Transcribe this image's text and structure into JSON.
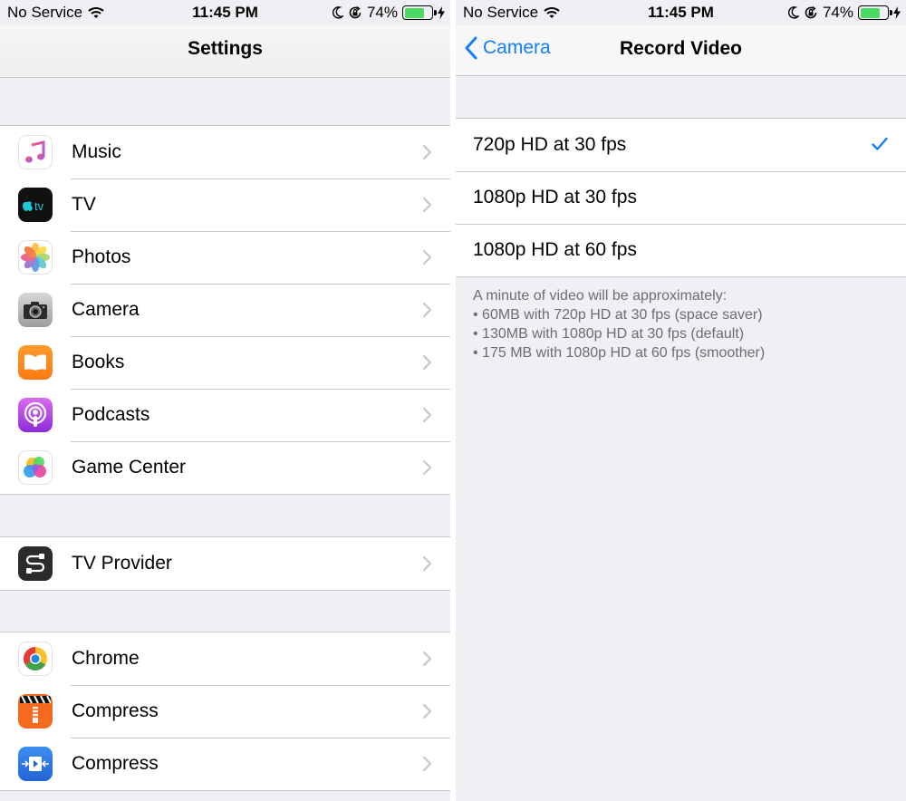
{
  "left": {
    "status": {
      "carrier": "No Service",
      "time": "11:45 PM",
      "battery": "74%",
      "battery_level": 0.74
    },
    "title": "Settings",
    "group1": [
      {
        "label": "Music",
        "icon": "music-icon"
      },
      {
        "label": "TV",
        "icon": "tv-icon"
      },
      {
        "label": "Photos",
        "icon": "photos-icon"
      },
      {
        "label": "Camera",
        "icon": "camera-icon"
      },
      {
        "label": "Books",
        "icon": "books-icon"
      },
      {
        "label": "Podcasts",
        "icon": "podcasts-icon"
      },
      {
        "label": "Game Center",
        "icon": "game-center-icon"
      }
    ],
    "group2": [
      {
        "label": "TV Provider",
        "icon": "tv-provider-icon"
      }
    ],
    "group3": [
      {
        "label": "Chrome",
        "icon": "chrome-icon"
      },
      {
        "label": "Compress",
        "icon": "compress-zip-icon"
      },
      {
        "label": "Compress",
        "icon": "compress-video-icon"
      }
    ]
  },
  "right": {
    "status": {
      "carrier": "No Service",
      "time": "11:45 PM",
      "battery": "74%",
      "battery_level": 0.74
    },
    "back_label": "Camera",
    "title": "Record Video",
    "options": [
      {
        "label": "720p HD at 30 fps",
        "selected": true
      },
      {
        "label": "1080p HD at 30 fps",
        "selected": false
      },
      {
        "label": "1080p HD at 60 fps",
        "selected": false
      }
    ],
    "footnote": [
      "A minute of video will be approximately:",
      "• 60MB with 720p HD at 30 fps (space saver)",
      "• 130MB with 1080p HD at 30 fps (default)",
      "• 175 MB with 1080p HD at 60 fps (smoother)"
    ]
  },
  "colors": {
    "accent": "#147efb",
    "battery_fill": "#4cd964",
    "group_bg": "#efeff4",
    "separator": "#c8c7cc",
    "footnote": "#6d6d72"
  }
}
